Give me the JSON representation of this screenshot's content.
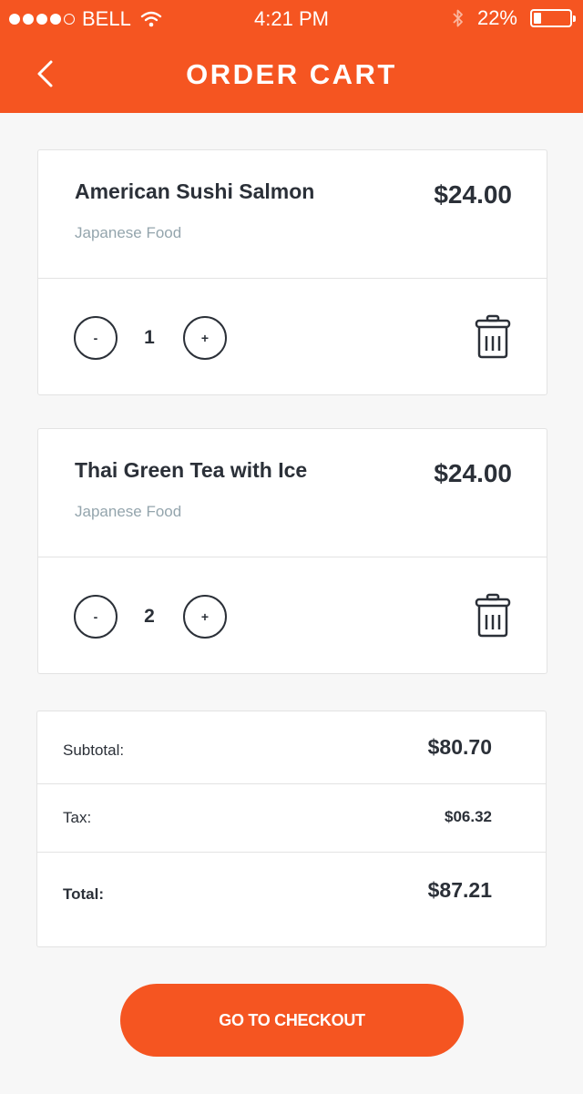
{
  "status_bar": {
    "carrier": "BELL",
    "time": "4:21 PM",
    "battery": "22%",
    "battery_level": 0.22,
    "signal_bars": 4
  },
  "header": {
    "title": "ORDER CART",
    "back_icon": "chevron-left-icon"
  },
  "cart_items": [
    {
      "name": "American Sushi Salmon",
      "category": "Japanese Food",
      "price": "$24.00",
      "quantity": "1",
      "minus_label": "-",
      "plus_label": "+"
    },
    {
      "name": "Thai Green Tea with Ice",
      "category": "Japanese Food",
      "price": "$24.00",
      "quantity": "2",
      "minus_label": "-",
      "plus_label": "+"
    }
  ],
  "summary": {
    "subtotal_label": "Subtotal:",
    "subtotal_value": "$80.70",
    "tax_label": "Tax:",
    "tax_value": "$06.32",
    "total_label": "Total:",
    "total_value": "$87.21"
  },
  "checkout_button": "GO TO CHECKOUT",
  "colors": {
    "accent": "#f55521",
    "text": "#2b3038",
    "muted": "#94a5ad",
    "background": "#f7f7f7"
  }
}
